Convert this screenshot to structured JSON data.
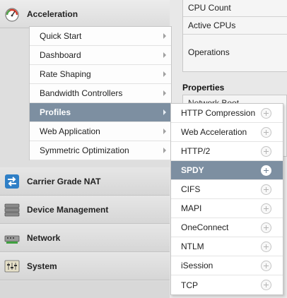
{
  "stats": {
    "rows": [
      "CPU Count",
      "Active CPUs",
      "Operations"
    ]
  },
  "properties": {
    "title": "Properties",
    "first_row": "Network Boot"
  },
  "nav": {
    "sections": [
      {
        "label": "Acceleration",
        "icon": "speedometer-icon",
        "active": true
      },
      {
        "label": "Carrier Grade NAT",
        "icon": "nat-arrows-icon"
      },
      {
        "label": "Device Management",
        "icon": "server-stack-icon"
      },
      {
        "label": "Network",
        "icon": "network-switch-icon"
      },
      {
        "label": "System",
        "icon": "system-sliders-icon"
      }
    ]
  },
  "submenu": {
    "items": [
      {
        "label": "Quick Start"
      },
      {
        "label": "Dashboard"
      },
      {
        "label": "Rate Shaping"
      },
      {
        "label": "Bandwidth Controllers"
      },
      {
        "label": "Profiles",
        "selected": true
      },
      {
        "label": "Web Application"
      },
      {
        "label": "Symmetric Optimization"
      }
    ]
  },
  "profiles_flyout": {
    "items": [
      {
        "label": "HTTP Compression"
      },
      {
        "label": "Web Acceleration"
      },
      {
        "label": "HTTP/2"
      },
      {
        "label": "SPDY",
        "selected": true
      },
      {
        "label": "CIFS"
      },
      {
        "label": "MAPI"
      },
      {
        "label": "OneConnect"
      },
      {
        "label": "NTLM"
      },
      {
        "label": "iSession"
      },
      {
        "label": "TCP"
      }
    ]
  },
  "colors": {
    "selected_bg": "#7d8fa1",
    "menu_bg": "#fdfdfd",
    "nav_bg": "#dedede"
  }
}
